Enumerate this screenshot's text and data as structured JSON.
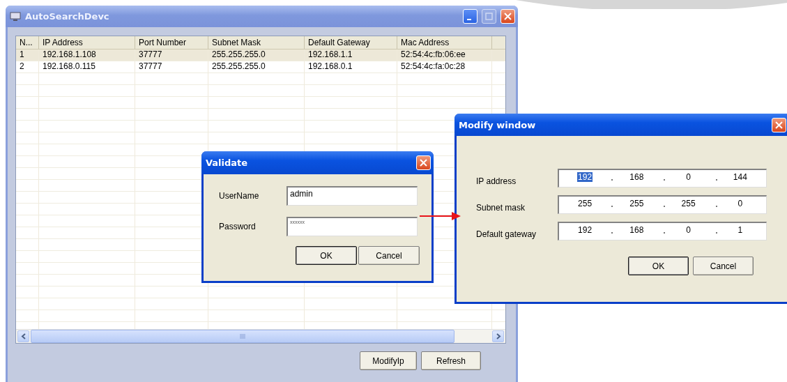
{
  "main_window": {
    "title": "AutoSearchDevc",
    "controls": [
      {
        "kind": "minimize",
        "disabled": false
      },
      {
        "kind": "maximize",
        "disabled": true
      },
      {
        "kind": "close",
        "disabled": false
      }
    ],
    "table": {
      "columns": [
        "N...",
        "IP Address",
        "Port Number",
        "Subnet Mask",
        "Default Gateway",
        "Mac Address"
      ],
      "rows": [
        {
          "cells": [
            "1",
            "192.168.1.108",
            "37777",
            "255.255.255.0",
            "192.168.1.1",
            "52:54:4c:fb:06:ee"
          ],
          "selected": true
        },
        {
          "cells": [
            "2",
            "192.168.0.115",
            "37777",
            "255.255.255.0",
            "192.168.0.1",
            "52:54:4c:fa:0c:28"
          ],
          "selected": false
        }
      ]
    },
    "buttons": [
      "ModifyIp",
      "Refresh"
    ]
  },
  "validate_dialog": {
    "title": "Validate",
    "fields": [
      {
        "label": "UserName",
        "value": "admin",
        "kind": "text"
      },
      {
        "label": "Password",
        "value": "xxxxxx",
        "kind": "password"
      }
    ],
    "buttons": [
      {
        "label": "OK",
        "selected": true
      },
      {
        "label": "Cancel",
        "selected": false
      }
    ]
  },
  "modify_window": {
    "title": "Modify window",
    "fields": [
      {
        "label": "IP address",
        "octets": [
          {
            "value": "192",
            "selected": true
          },
          {
            "value": "168",
            "selected": false
          },
          {
            "value": "0",
            "selected": false
          },
          {
            "value": "144",
            "selected": false
          }
        ]
      },
      {
        "label": "Subnet mask",
        "octets": [
          {
            "value": "255",
            "selected": false
          },
          {
            "value": "255",
            "selected": false
          },
          {
            "value": "255",
            "selected": false
          },
          {
            "value": "0",
            "selected": false
          }
        ]
      },
      {
        "label": "Default gateway",
        "octets": [
          {
            "value": "192",
            "selected": false
          },
          {
            "value": "168",
            "selected": false
          },
          {
            "value": "0",
            "selected": false
          },
          {
            "value": "1",
            "selected": false
          }
        ]
      }
    ],
    "buttons": [
      {
        "label": "OK",
        "selected": true
      },
      {
        "label": "Cancel",
        "selected": false
      }
    ]
  }
}
